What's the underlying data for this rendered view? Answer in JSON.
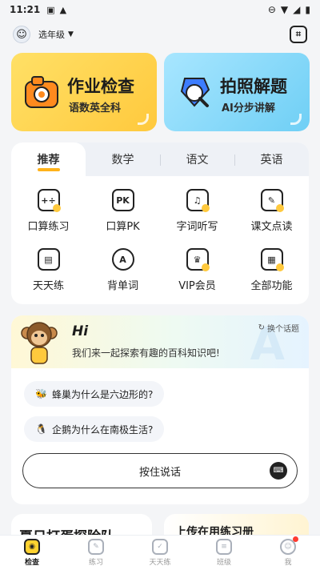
{
  "status_bar": {
    "time": "11:21"
  },
  "top_bar": {
    "grade": "选年级"
  },
  "cards": [
    {
      "title": "作业检查",
      "subtitle": "语数英全科"
    },
    {
      "title": "拍照解题",
      "subtitle": "AI分步讲解"
    }
  ],
  "tabs": [
    "推荐",
    "数学",
    "语文",
    "英语"
  ],
  "features": [
    {
      "label": "口算练习",
      "icon": "calc-practice-icon",
      "glyph": "+÷"
    },
    {
      "label": "口算PK",
      "icon": "pk-icon",
      "glyph": "PK"
    },
    {
      "label": "字词听写",
      "icon": "headphones-icon",
      "glyph": "♫"
    },
    {
      "label": "课文点读",
      "icon": "book-read-icon",
      "glyph": "✎"
    },
    {
      "label": "天天练",
      "icon": "calendar-icon",
      "glyph": "📅"
    },
    {
      "label": "背单词",
      "icon": "letter-a-icon",
      "glyph": "A"
    },
    {
      "label": "VIP会员",
      "icon": "vip-crown-icon",
      "glyph": "♛"
    },
    {
      "label": "全部功能",
      "icon": "grid-all-icon",
      "glyph": "▦"
    }
  ],
  "chat": {
    "hi": "Hi",
    "intro": "我们来一起探索有趣的百科知识吧!",
    "swap_label": "换个话题",
    "questions": [
      {
        "emoji": "🐝",
        "text": "蜂巢为什么是六边形的?"
      },
      {
        "emoji": "🐧",
        "text": "企鹅为什么在南极生活?"
      }
    ],
    "hold_to_talk": "按住说话"
  },
  "peek": {
    "left_title": "夏日打蛋探险队",
    "right_title": "上传在用练习册"
  },
  "nav": [
    {
      "label": "检查",
      "active": true
    },
    {
      "label": "练习",
      "active": false
    },
    {
      "label": "天天练",
      "active": false
    },
    {
      "label": "班级",
      "active": false
    },
    {
      "label": "我",
      "active": false,
      "badge": true
    }
  ],
  "colors": {
    "accent_yellow": "#ffc93d",
    "accent_blue": "#6fcff5",
    "tab_underline": "#ffb21a",
    "badge_red": "#ff3b30"
  }
}
